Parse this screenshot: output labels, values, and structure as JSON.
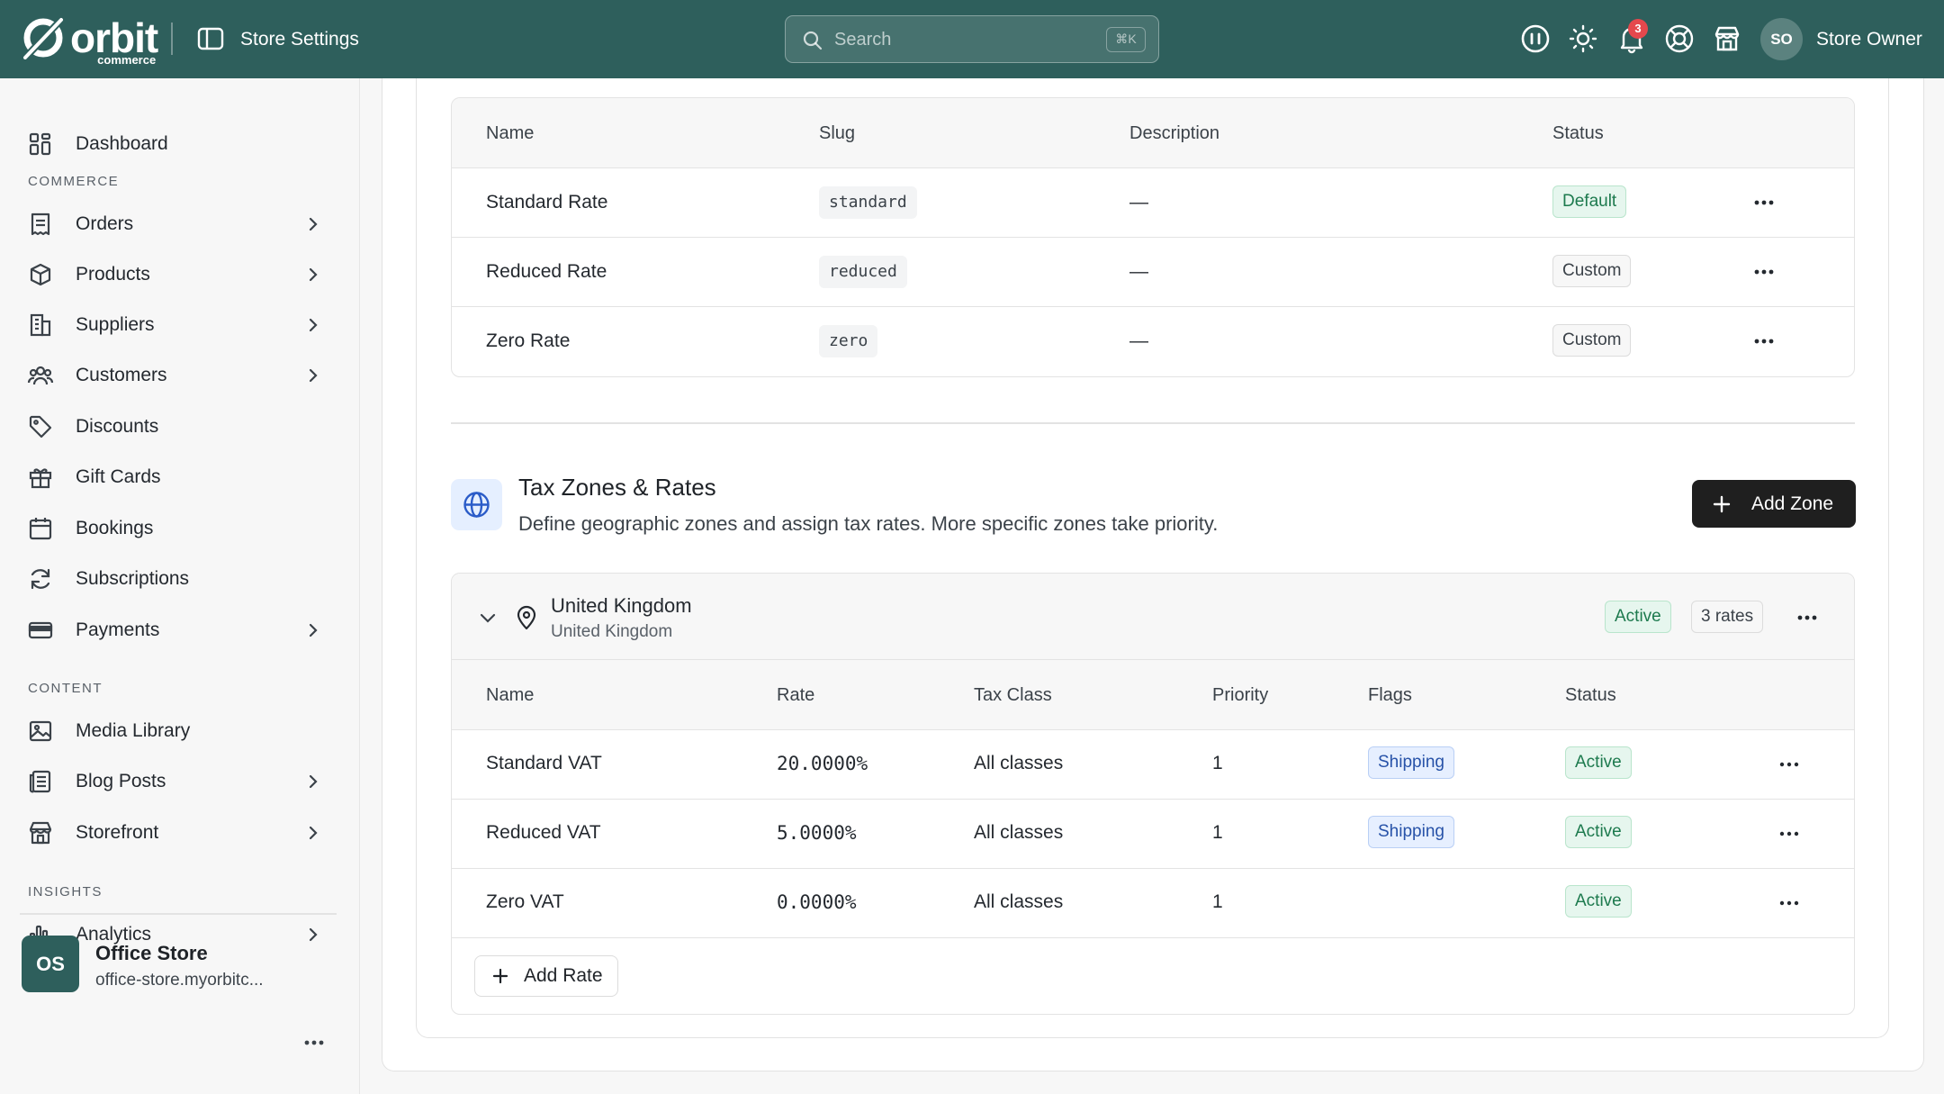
{
  "header": {
    "brand": "orbit",
    "brand_sub": "commerce",
    "title": "Store Settings",
    "search_placeholder": "Search",
    "search_shortcut": "⌘K",
    "notification_count": "3",
    "user_initials": "SO",
    "user_name": "Store Owner"
  },
  "sidebar": {
    "dashboard": "Dashboard",
    "sections": {
      "commerce": "COMMERCE",
      "content": "CONTENT",
      "insights": "INSIGHTS"
    },
    "items": {
      "orders": "Orders",
      "products": "Products",
      "suppliers": "Suppliers",
      "customers": "Customers",
      "discounts": "Discounts",
      "gift_cards": "Gift Cards",
      "bookings": "Bookings",
      "subscriptions": "Subscriptions",
      "payments": "Payments",
      "media_library": "Media Library",
      "blog_posts": "Blog Posts",
      "storefront": "Storefront",
      "analytics": "Analytics"
    },
    "store": {
      "initials": "OS",
      "name": "Office Store",
      "url": "office-store.myorbitc..."
    }
  },
  "tax_classes": {
    "columns": {
      "name": "Name",
      "slug": "Slug",
      "description": "Description",
      "status": "Status"
    },
    "rows": [
      {
        "name": "Standard Rate",
        "slug": "standard",
        "description": "—",
        "status": "Default"
      },
      {
        "name": "Reduced Rate",
        "slug": "reduced",
        "description": "—",
        "status": "Custom"
      },
      {
        "name": "Zero Rate",
        "slug": "zero",
        "description": "—",
        "status": "Custom"
      }
    ]
  },
  "tax_zones": {
    "title": "Tax Zones & Rates",
    "description": "Define geographic zones and assign tax rates. More specific zones take priority.",
    "add_zone_label": "Add Zone",
    "zone": {
      "name": "United Kingdom",
      "subtitle": "United Kingdom",
      "status": "Active",
      "rates_count": "3 rates",
      "columns": {
        "name": "Name",
        "rate": "Rate",
        "tax_class": "Tax Class",
        "priority": "Priority",
        "flags": "Flags",
        "status": "Status"
      },
      "rows": [
        {
          "name": "Standard VAT",
          "rate": "20.0000%",
          "tax_class": "All classes",
          "priority": "1",
          "flag": "Shipping",
          "status": "Active"
        },
        {
          "name": "Reduced VAT",
          "rate": "5.0000%",
          "tax_class": "All classes",
          "priority": "1",
          "flag": "Shipping",
          "status": "Active"
        },
        {
          "name": "Zero VAT",
          "rate": "0.0000%",
          "tax_class": "All classes",
          "priority": "1",
          "flag": "",
          "status": "Active"
        }
      ],
      "add_rate_label": "Add Rate"
    }
  },
  "colors": {
    "header_bg": "#2e5f5c",
    "accent_green": "#1d7a4e",
    "badge_red": "#e5484d",
    "shipping_blue": "#2752a8"
  }
}
